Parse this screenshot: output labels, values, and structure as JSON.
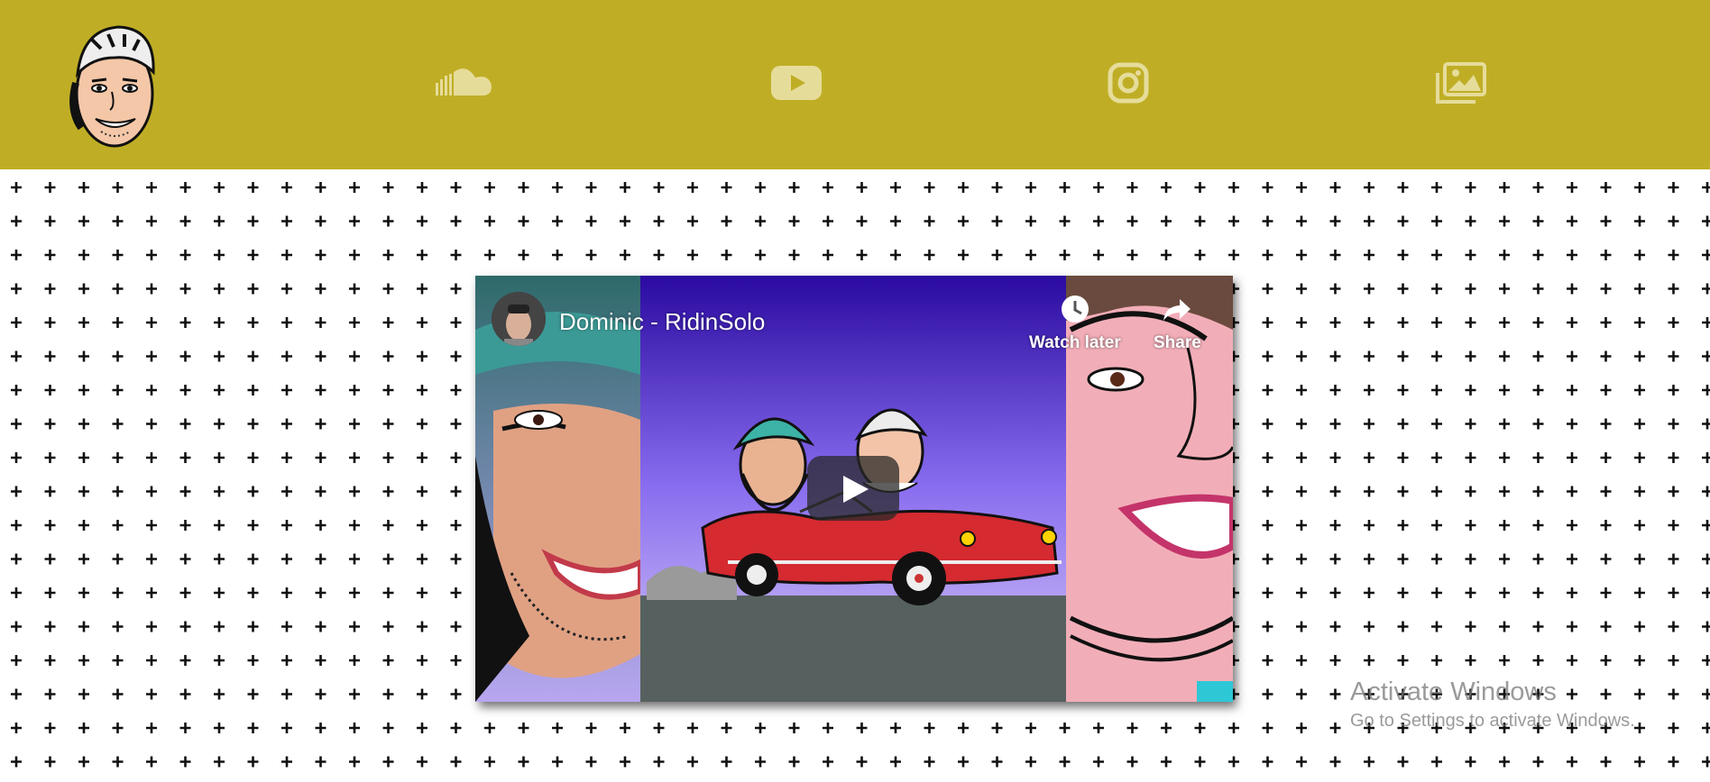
{
  "header": {
    "background_color": "#bfae25",
    "logo_icon": "cartoon-face-logo",
    "nav_icons": [
      "soundcloud-icon",
      "youtube-icon",
      "instagram-icon",
      "gallery-icon"
    ]
  },
  "background": {
    "pattern_icon": "plus-pattern",
    "pattern_color": "#111111"
  },
  "video": {
    "title": "Dominic - RidinSolo",
    "watch_later_label": "Watch later",
    "share_label": "Share",
    "play_icon": "play-icon"
  },
  "os_overlay": {
    "line1": "Activate Windows",
    "line2": "Go to Settings to activate Windows."
  }
}
